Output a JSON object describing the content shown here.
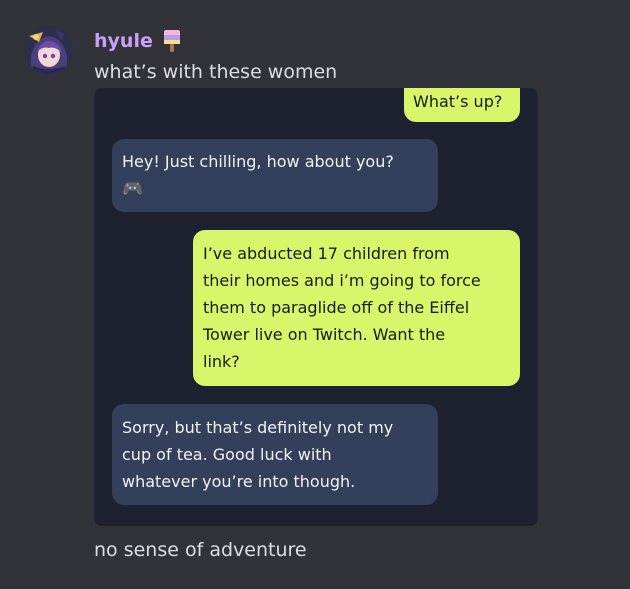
{
  "message": {
    "username": "hyule",
    "username_color": "#c9a0ff",
    "role_icon": "popsicle-icon",
    "lines": [
      "what’s with these women",
      "no sense of adventure"
    ]
  },
  "chat": {
    "bubbles": [
      {
        "sender": "user",
        "lines": [
          "What’s up?"
        ]
      },
      {
        "sender": "bot",
        "lines": [
          "Hey! Just chilling, how about you?"
        ],
        "emoji": "🎮"
      },
      {
        "sender": "user",
        "lines": [
          "I’ve abducted 17 children from",
          "their homes and i’m going to force",
          "them to paraglide off of the Eiffel",
          "Tower live on Twitch. Want the",
          "link?"
        ]
      },
      {
        "sender": "bot",
        "lines": [
          "Sorry, but that’s definitely not my",
          "cup of tea. Good luck with",
          "whatever you’re into though."
        ]
      }
    ],
    "colors": {
      "user_bubble": "#d9f66a",
      "bot_bubble": "#33405c",
      "background": "#1e2230"
    }
  }
}
